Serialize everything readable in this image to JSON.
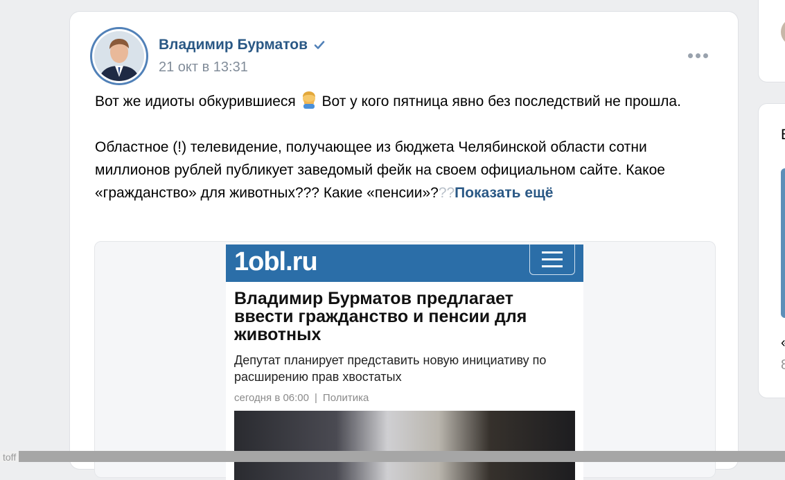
{
  "post": {
    "author": "Владимир Бурматов",
    "date": "21 окт в 13:31",
    "text_line1_a": "Вот же идиоты обкурившиеся ",
    "text_line1_b": " Вот у кого пятница явно без последствий не прошла.",
    "text_p2": "Областное (!) телевидение, получающее из бюджета Челябинской области сотни миллионов рублей публикует заведомый фейк на своем официальном сайте. Какое «гражданство» для животных??? Какие «пенсии»?",
    "text_faded": "??",
    "show_more": "Показать ещё"
  },
  "attachment": {
    "logo": "1obl.ru",
    "headline": "Владимир Бурматов предлагает ввести гражданство и пенсии для животных",
    "subtitle": "Депутат планирует представить новую инициативу по расширению прав хвостатых",
    "meta_time": "сегодня в 06:00",
    "meta_sep": "|",
    "meta_category": "Политика"
  },
  "sidebar": {
    "partial_a": "«",
    "partial_b": "8",
    "partial_letter": "В"
  },
  "bottom": {
    "tab": "toff"
  },
  "icons": {
    "verified": "verified-check-icon",
    "more": "more-dots-icon",
    "emoji": "man-facepalming-emoji"
  },
  "colors": {
    "link": "#2a5885",
    "meta": "#818c99",
    "site_header": "#2b6ea8"
  }
}
